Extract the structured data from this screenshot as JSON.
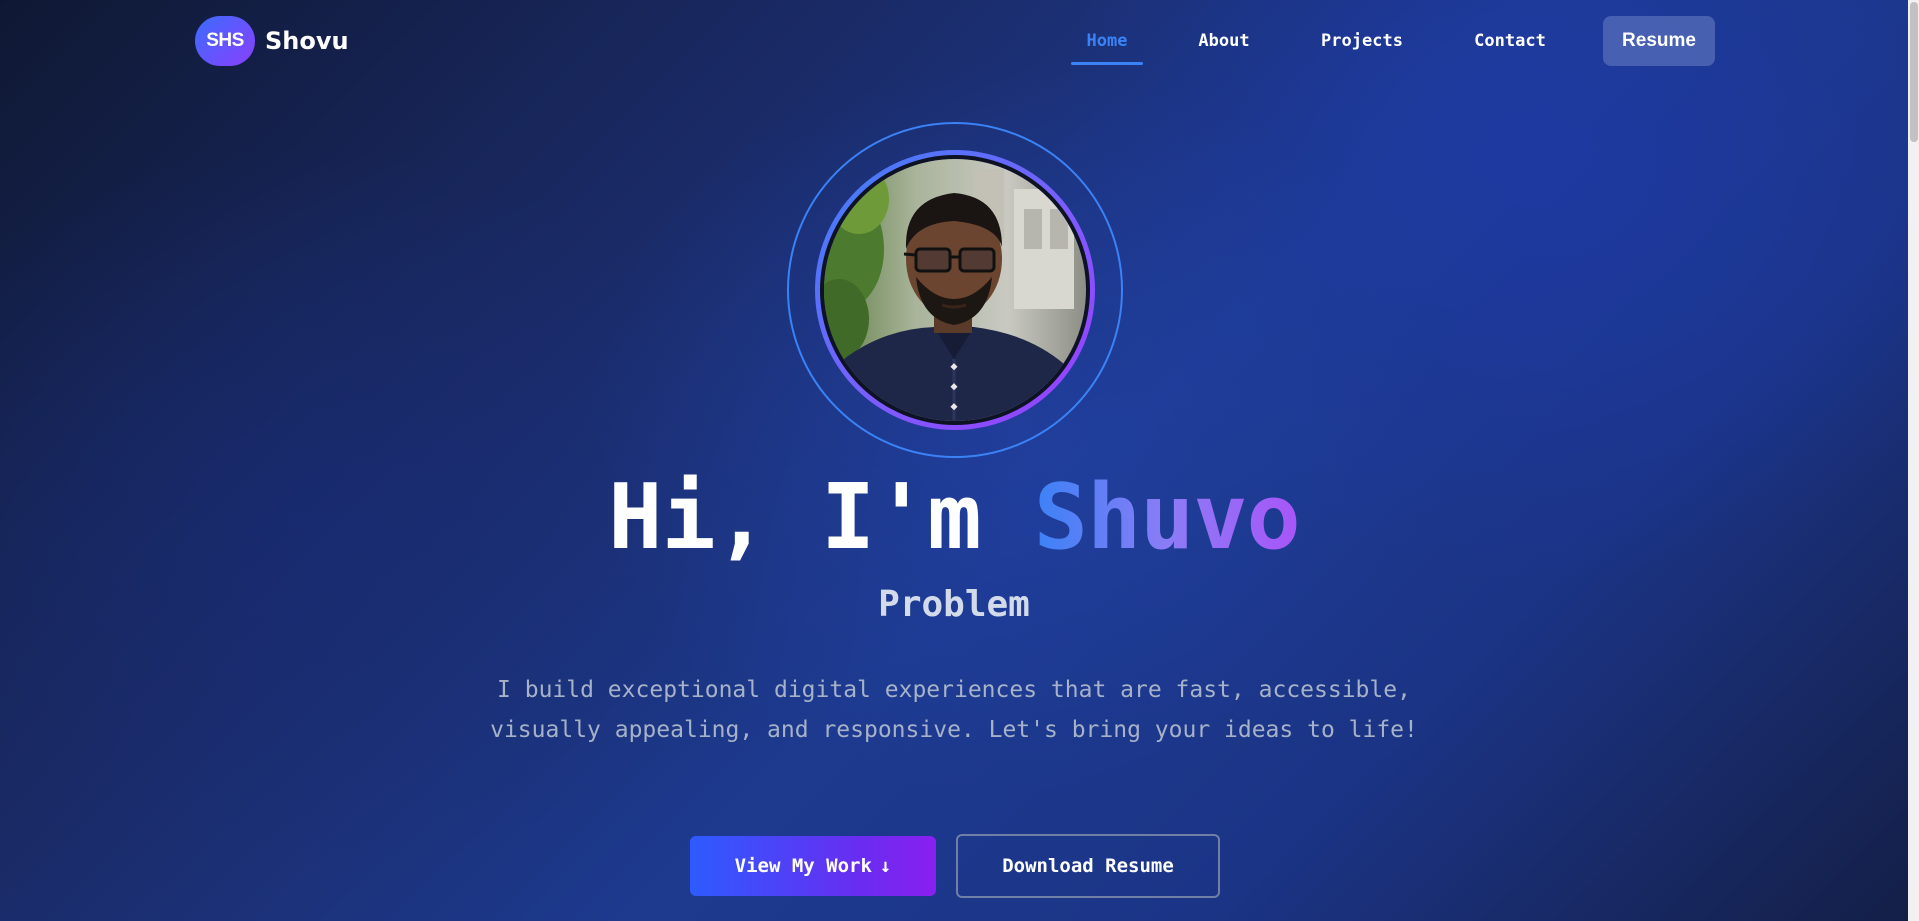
{
  "brand": {
    "badge": "SHS",
    "name": "Shovu"
  },
  "nav": {
    "items": [
      {
        "label": "Home",
        "active": true
      },
      {
        "label": "About",
        "active": false
      },
      {
        "label": "Projects",
        "active": false
      },
      {
        "label": "Contact",
        "active": false
      }
    ],
    "resume_label": "Resume"
  },
  "hero": {
    "greeting": "Hi, I'm ",
    "name": "Shuvo",
    "role": "Problem",
    "tagline": "I build exceptional digital experiences that are fast, accessible, visually appealing, and responsive. Let's bring your ideas to life!",
    "primary_button": "View My Work",
    "primary_button_icon": "↓",
    "secondary_button": "Download Resume",
    "avatar_icon": "profile-photo"
  },
  "colors": {
    "accent": "#3b82f6",
    "gradient_start": "#3b82f6",
    "gradient_end": "#a855f7",
    "background": "#1d3a8f"
  }
}
